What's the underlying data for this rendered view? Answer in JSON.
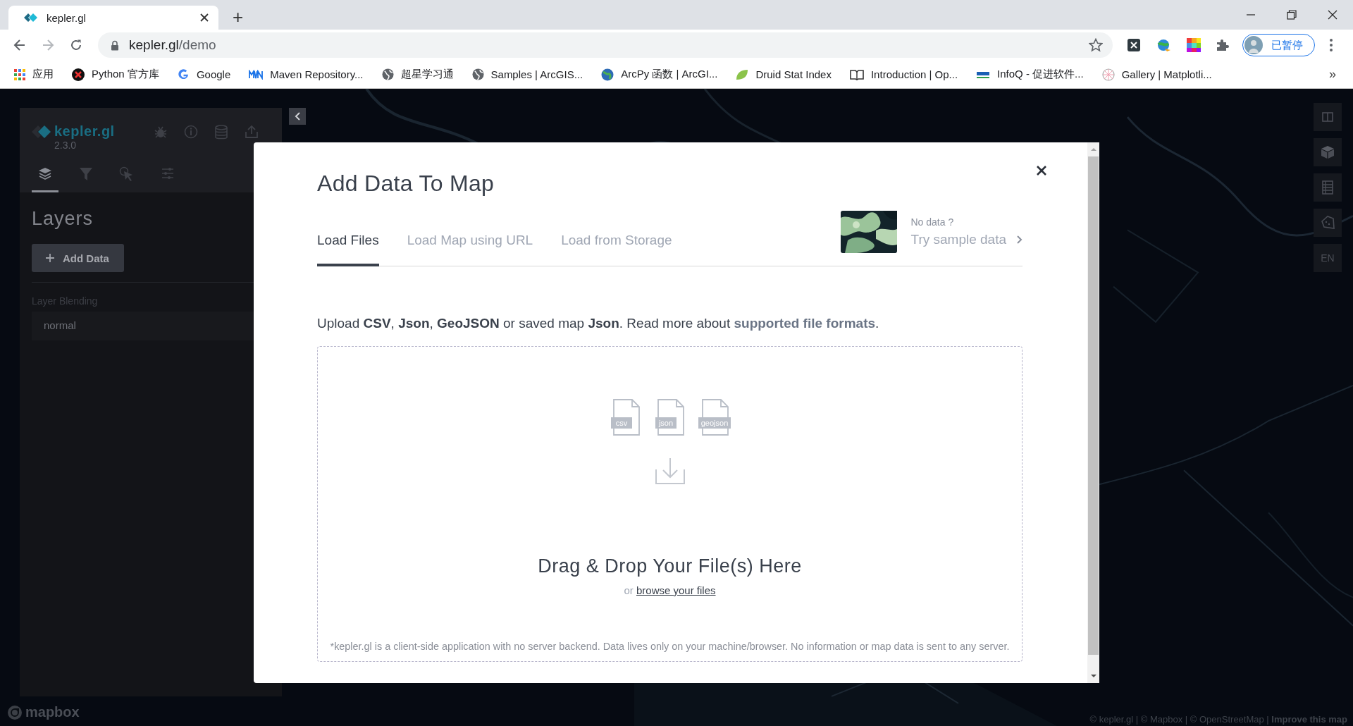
{
  "browser": {
    "tabs": [
      {
        "title": "kepler.gl",
        "selected": true
      }
    ],
    "new_tab": "+",
    "address": {
      "domain": "kepler.gl",
      "path": "/demo"
    },
    "extensions": [
      {
        "kind": "x"
      },
      {
        "kind": "globe"
      },
      {
        "kind": "grid"
      },
      {
        "kind": "puzzle"
      }
    ],
    "profile": "已暂停",
    "bookmarks": [
      {
        "label": "应用",
        "kind": "apps"
      },
      {
        "label": "Python 官方库",
        "kind": "python"
      },
      {
        "label": "Google",
        "kind": "google"
      },
      {
        "label": "Maven Repository...",
        "kind": "mvn"
      },
      {
        "label": "超星学习通",
        "kind": "globe"
      },
      {
        "label": "Samples | ArcGIS...",
        "kind": "globe"
      },
      {
        "label": "ArcPy 函数 | ArcGI...",
        "kind": "earth"
      },
      {
        "label": "Druid Stat Index",
        "kind": "leaf"
      },
      {
        "label": "Introduction | Op...",
        "kind": "book"
      },
      {
        "label": "InfoQ - 促进软件...",
        "kind": "infoq"
      },
      {
        "label": "Gallery | Matplotli...",
        "kind": "wheel"
      }
    ],
    "bookmarks_more": "»"
  },
  "sidebar": {
    "logo": "kepler.gl",
    "version": "2.3.0",
    "actions": [
      {
        "kind": "bug"
      },
      {
        "kind": "info"
      },
      {
        "kind": "database"
      },
      {
        "kind": "share"
      }
    ],
    "tabs": [
      {
        "kind": "layers",
        "selected": true
      },
      {
        "kind": "filter",
        "selected": false
      },
      {
        "kind": "interaction",
        "selected": false
      },
      {
        "kind": "settings",
        "selected": false
      }
    ],
    "title": "Layers",
    "add_button": "Add Data",
    "blending_label": "Layer Blending",
    "blending_value": "normal"
  },
  "map": {
    "controls": [
      {
        "kind": "split"
      },
      {
        "kind": "cube"
      },
      {
        "kind": "legend"
      },
      {
        "kind": "draw"
      },
      {
        "kind": "locale",
        "label": "EN"
      }
    ],
    "logo": "mapbox",
    "attribution": "© kepler.gl | © Mapbox | © OpenStreetMap | **Improve this map**"
  },
  "modal": {
    "title": "Add Data To Map",
    "tabs": [
      {
        "label": "Load Files",
        "selected": true
      },
      {
        "label": "Load Map using URL",
        "selected": false
      },
      {
        "label": "Load from Storage",
        "selected": false
      }
    ],
    "sample": {
      "hint": "No data ?",
      "link": "Try sample data"
    },
    "intro": "Upload **CSV**, **Json**, **GeoJSON** or saved map **Json**. Read more about",
    "intro_link": "supported file formats",
    "intro_end": ".",
    "file_types": [
      "csv",
      "json",
      "geojson"
    ],
    "drop_title": "Drag & Drop Your File(s) Here",
    "browse_prefix": "or",
    "browse_link": "browse your files",
    "disclaimer": "*kepler.gl is a client-side application with no server backend. Data lives only on your machine/browser. No information or map data is sent to any server."
  }
}
